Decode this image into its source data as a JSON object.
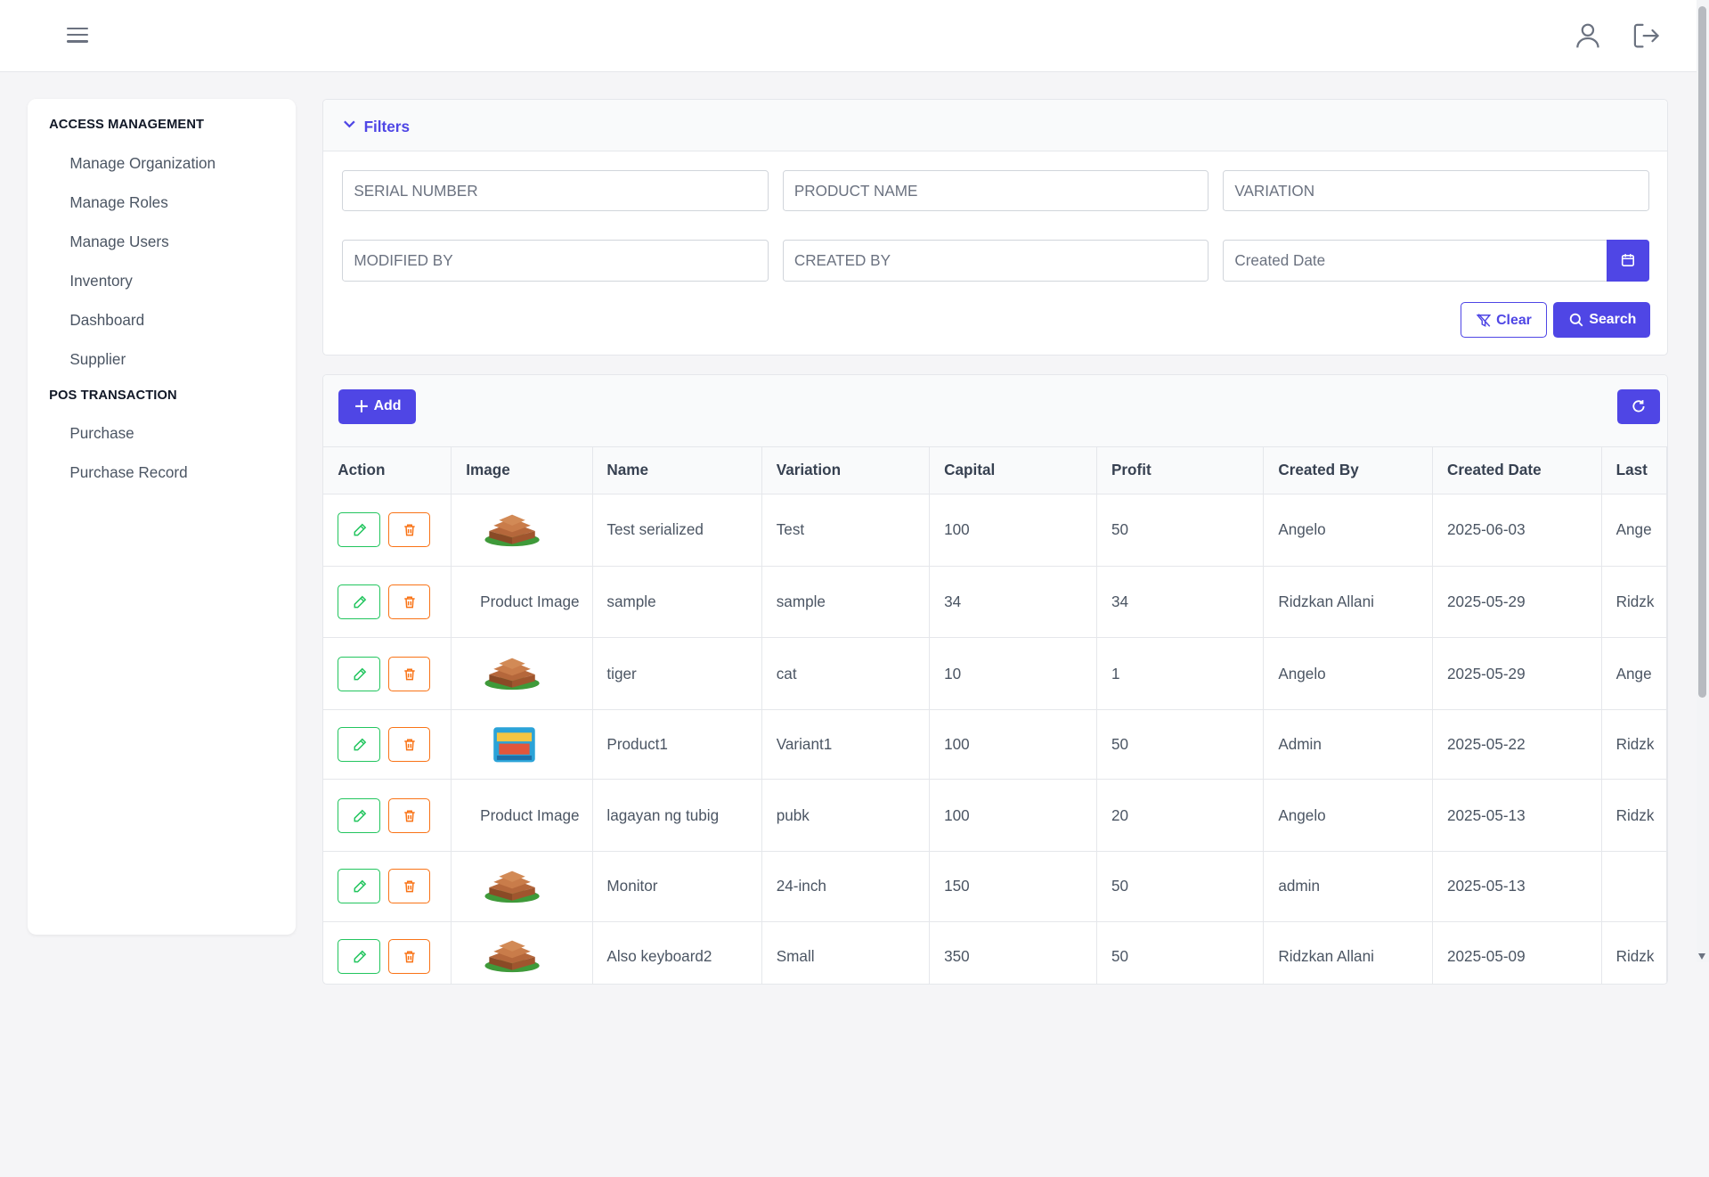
{
  "topbar": {
    "menu_icon": "hamburger-icon",
    "user_icon": "user-icon",
    "logout_icon": "logout-icon"
  },
  "sidebar": {
    "sections": [
      {
        "title": "ACCESS MANAGEMENT",
        "items": [
          "Manage Organization",
          "Manage Roles",
          "Manage Users",
          "Inventory",
          "Dashboard",
          "Supplier"
        ]
      },
      {
        "title": "POS TRANSACTION",
        "items": [
          "Purchase",
          "Purchase Record"
        ]
      }
    ]
  },
  "filters": {
    "title": "Filters",
    "fields": {
      "serial": {
        "placeholder": "SERIAL NUMBER"
      },
      "product": {
        "placeholder": "PRODUCT NAME"
      },
      "variation": {
        "placeholder": "VARIATION"
      },
      "modified": {
        "placeholder": "MODIFIED BY"
      },
      "created": {
        "placeholder": "CREATED BY"
      },
      "date": {
        "placeholder": "Created Date"
      }
    },
    "clear_label": "Clear",
    "search_label": "Search"
  },
  "toolbar": {
    "add_label": "Add"
  },
  "table": {
    "columns": [
      "Action",
      "Image",
      "Name",
      "Variation",
      "Capital",
      "Profit",
      "Created By",
      "Created Date",
      "Last"
    ],
    "image_alt": "Product Image",
    "rows": [
      {
        "image": "bench",
        "name": "Test serialized",
        "variation": "Test",
        "capital": "100",
        "profit": "50",
        "created_by": "Angelo",
        "created_date": "2025-06-03",
        "last": "Ange"
      },
      {
        "image": "broken",
        "name": "sample",
        "variation": "sample",
        "capital": "34",
        "profit": "34",
        "created_by": "Ridzkan Allani",
        "created_date": "2025-05-29",
        "last": "Ridzk"
      },
      {
        "image": "bench",
        "name": "tiger",
        "variation": "cat",
        "capital": "10",
        "profit": "1",
        "created_by": "Angelo",
        "created_date": "2025-05-29",
        "last": "Ange"
      },
      {
        "image": "snack",
        "name": "Product1",
        "variation": "Variant1",
        "capital": "100",
        "profit": "50",
        "created_by": "Admin",
        "created_date": "2025-05-22",
        "last": "Ridzk"
      },
      {
        "image": "broken",
        "name": "lagayan ng tubig",
        "variation": "pubk",
        "capital": "100",
        "profit": "20",
        "created_by": "Angelo",
        "created_date": "2025-05-13",
        "last": "Ridzk"
      },
      {
        "image": "bench",
        "name": "Monitor",
        "variation": "24-inch",
        "capital": "150",
        "profit": "50",
        "created_by": "admin",
        "created_date": "2025-05-13",
        "last": ""
      },
      {
        "image": "bench",
        "name": "Also keyboard2",
        "variation": "Small",
        "capital": "350",
        "profit": "50",
        "created_by": "Ridzkan Allani",
        "created_date": "2025-05-09",
        "last": "Ridzk"
      }
    ]
  },
  "colors": {
    "primary": "#4f46e5",
    "edit": "#22c55e",
    "delete": "#f97316"
  }
}
